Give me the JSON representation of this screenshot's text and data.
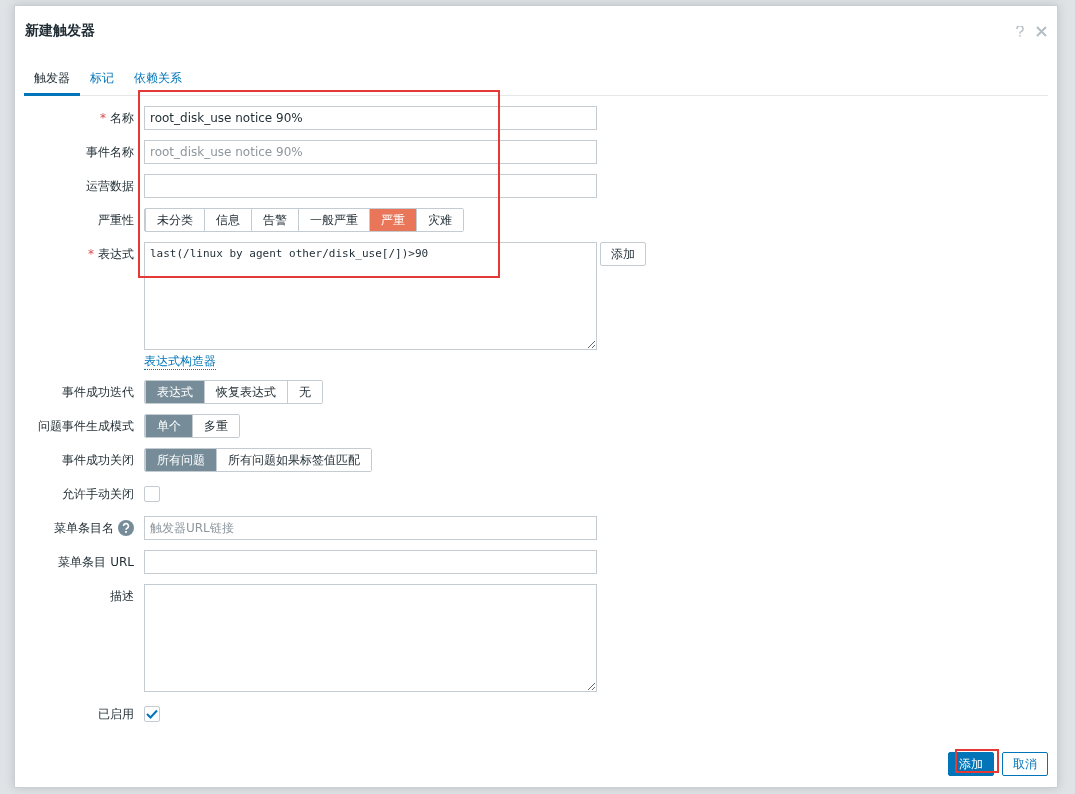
{
  "dialog": {
    "title": "新建触发器"
  },
  "tabs": [
    {
      "label": "触发器",
      "selected": true
    },
    {
      "label": "标记",
      "selected": false
    },
    {
      "label": "依赖关系",
      "selected": false
    }
  ],
  "form": {
    "highlighted": true
  },
  "fields": [
    {
      "kind": "text",
      "label": "名称",
      "marker": "*",
      "value": "root_disk_use notice 90%"
    },
    {
      "kind": "text",
      "label": "事件名称",
      "placeholder": "root_disk_use notice 90%"
    },
    {
      "kind": "text",
      "label": "运营数据"
    },
    {
      "kind": "severity",
      "label": "严重性",
      "options": [
        {
          "label": "未分类",
          "selected": false
        },
        {
          "label": "信息",
          "selected": false
        },
        {
          "label": "告警",
          "selected": false
        },
        {
          "label": "一般严重",
          "selected": false
        },
        {
          "label": "严重",
          "selected": true
        },
        {
          "label": "灾难",
          "selected": false
        }
      ]
    },
    {
      "kind": "expression",
      "label": "表达式",
      "marker": "*",
      "value": "last(/linux by agent other/disk_use[/])>90",
      "button": "添加",
      "link": "表达式构造器"
    },
    {
      "kind": "segmented",
      "label": "事件成功迭代",
      "options": [
        {
          "label": "表达式",
          "selected": true
        },
        {
          "label": "恢复表达式",
          "selected": false
        },
        {
          "label": "无",
          "selected": false
        }
      ]
    },
    {
      "kind": "segmented",
      "label": "问题事件生成模式",
      "options": [
        {
          "label": "单个",
          "selected": true
        },
        {
          "label": "多重",
          "selected": false
        }
      ]
    },
    {
      "kind": "segmented",
      "label": "事件成功关闭",
      "options": [
        {
          "label": "所有问题",
          "selected": true
        },
        {
          "label": "所有问题如果标签值匹配",
          "selected": false
        }
      ]
    },
    {
      "kind": "checkbox",
      "label": "允许手动关闭",
      "checked": false
    },
    {
      "kind": "text",
      "label": "菜单条目名",
      "help": true,
      "placeholder": "触发器URL链接"
    },
    {
      "kind": "text",
      "label": "菜单条目 URL"
    },
    {
      "kind": "textarea",
      "label": "描述"
    },
    {
      "kind": "checkbox",
      "label": "已启用",
      "checked": true
    }
  ],
  "footer": {
    "buttons": [
      {
        "label": "添加",
        "primary": true,
        "highlighted": true
      },
      {
        "label": "取消",
        "primary": false,
        "highlighted": false
      }
    ]
  }
}
